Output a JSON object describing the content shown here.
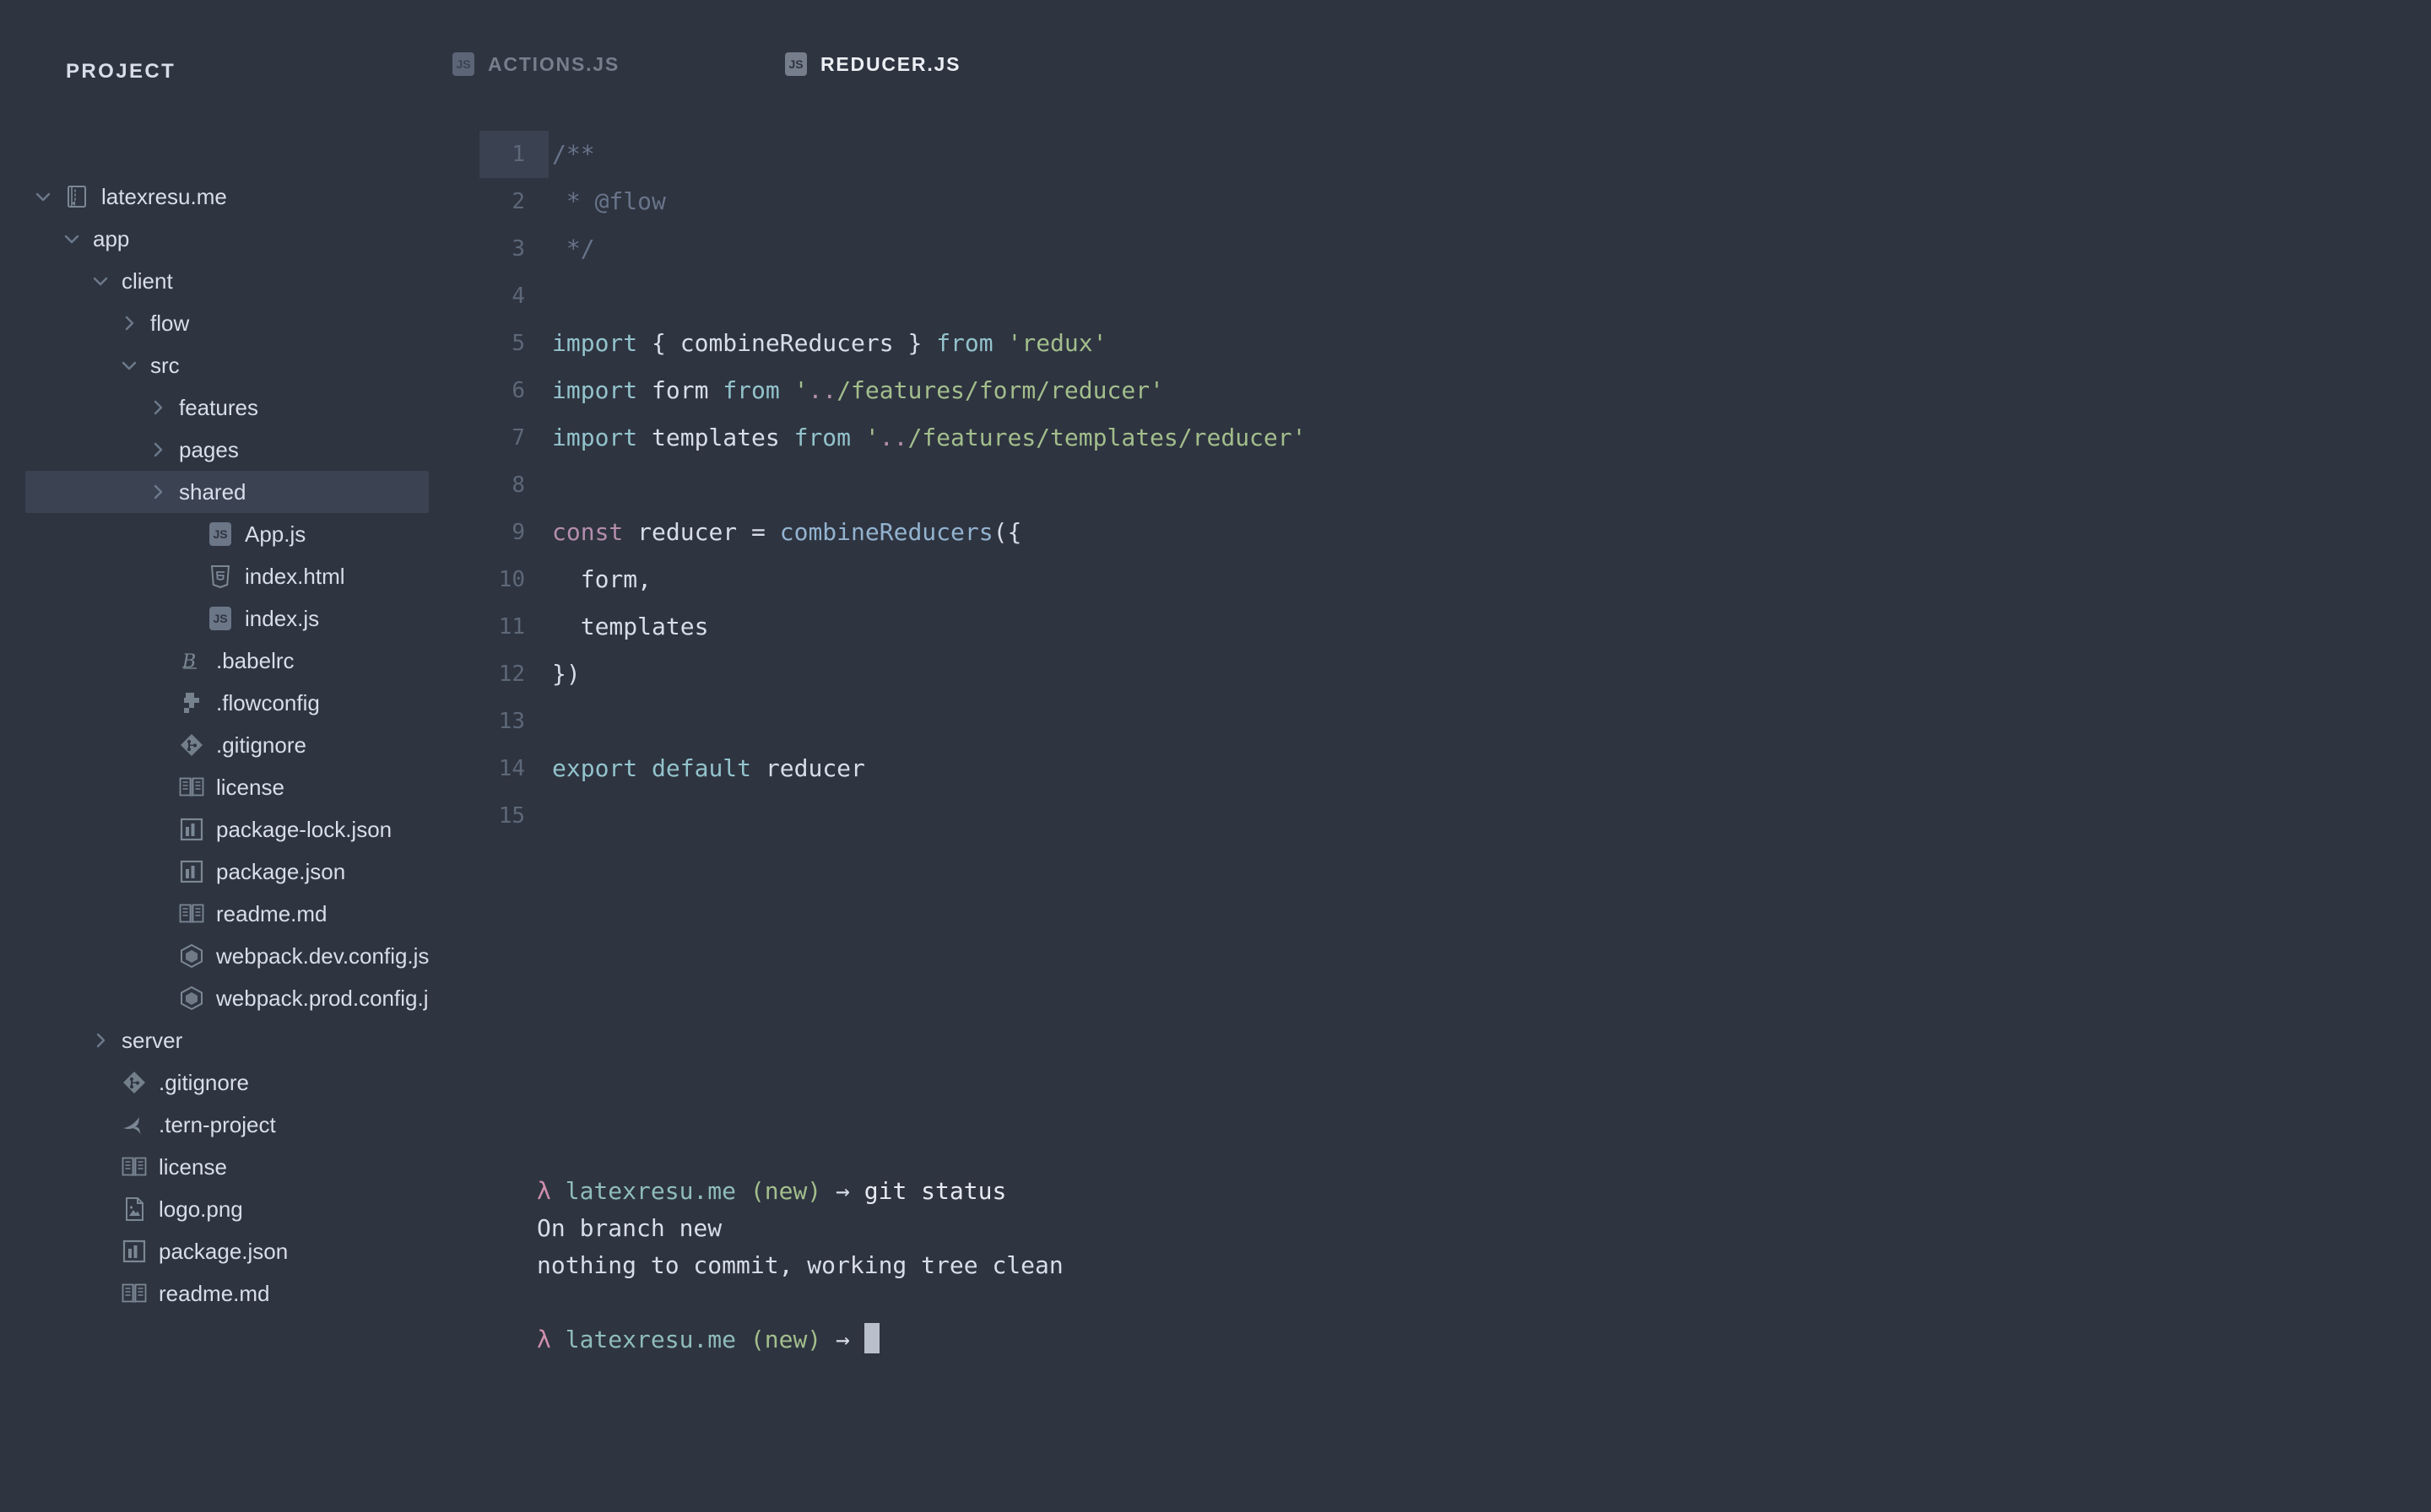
{
  "theme": {
    "bg": "#2e3440",
    "selection": "#3b4252",
    "active_line_gutter": "#3a4150",
    "text": "#d8dee9",
    "muted": "#68748a",
    "keyword": "#b48ead",
    "keyword2": "#93c3cc",
    "function": "#93b3d0",
    "string": "#a3be8c"
  },
  "sidebar": {
    "title": "PROJECT",
    "items": [
      {
        "label": "latexresu.me",
        "indent": 0,
        "chevron": "chevron-down",
        "icon": "repo-book",
        "selected": false
      },
      {
        "label": "app",
        "indent": 1,
        "chevron": "chevron-down",
        "icon": "none",
        "selected": false
      },
      {
        "label": "client",
        "indent": 2,
        "chevron": "chevron-down",
        "icon": "none",
        "selected": false
      },
      {
        "label": "flow",
        "indent": 3,
        "chevron": "chevron-right",
        "icon": "none",
        "selected": false
      },
      {
        "label": "src",
        "indent": 3,
        "chevron": "chevron-down",
        "icon": "none",
        "selected": false
      },
      {
        "label": "features",
        "indent": 4,
        "chevron": "chevron-right",
        "icon": "none",
        "selected": false
      },
      {
        "label": "pages",
        "indent": 4,
        "chevron": "chevron-right",
        "icon": "none",
        "selected": false
      },
      {
        "label": "shared",
        "indent": 4,
        "chevron": "chevron-right",
        "icon": "none",
        "selected": true
      },
      {
        "label": "App.js",
        "indent": 5,
        "chevron": "none",
        "icon": "js-file",
        "selected": false
      },
      {
        "label": "index.html",
        "indent": 5,
        "chevron": "none",
        "icon": "html5-file",
        "selected": false
      },
      {
        "label": "index.js",
        "indent": 5,
        "chevron": "none",
        "icon": "js-file",
        "selected": false
      },
      {
        "label": ".babelrc",
        "indent": 4,
        "chevron": "none",
        "icon": "babel-file",
        "selected": false
      },
      {
        "label": ".flowconfig",
        "indent": 4,
        "chevron": "none",
        "icon": "flow-file",
        "selected": false
      },
      {
        "label": ".gitignore",
        "indent": 4,
        "chevron": "none",
        "icon": "git-file",
        "selected": false
      },
      {
        "label": "license",
        "indent": 4,
        "chevron": "none",
        "icon": "book-file",
        "selected": false
      },
      {
        "label": "package-lock.json",
        "indent": 4,
        "chevron": "none",
        "icon": "json-file",
        "selected": false
      },
      {
        "label": "package.json",
        "indent": 4,
        "chevron": "none",
        "icon": "json-file",
        "selected": false
      },
      {
        "label": "readme.md",
        "indent": 4,
        "chevron": "none",
        "icon": "book-file",
        "selected": false
      },
      {
        "label": "webpack.dev.config.js",
        "indent": 4,
        "chevron": "none",
        "icon": "webpack-file",
        "selected": false
      },
      {
        "label": "webpack.prod.config.js",
        "indent": 4,
        "chevron": "none",
        "icon": "webpack-file",
        "selected": false
      },
      {
        "label": "server",
        "indent": 2,
        "chevron": "chevron-right",
        "icon": "none",
        "selected": false
      },
      {
        "label": ".gitignore",
        "indent": 2,
        "chevron": "none",
        "icon": "git-file",
        "selected": false
      },
      {
        "label": ".tern-project",
        "indent": 2,
        "chevron": "none",
        "icon": "tern-file",
        "selected": false
      },
      {
        "label": "license",
        "indent": 2,
        "chevron": "none",
        "icon": "book-file",
        "selected": false
      },
      {
        "label": "logo.png",
        "indent": 2,
        "chevron": "none",
        "icon": "image-file",
        "selected": false
      },
      {
        "label": "package.json",
        "indent": 2,
        "chevron": "none",
        "icon": "json-file",
        "selected": false
      },
      {
        "label": "readme.md",
        "indent": 2,
        "chevron": "none",
        "icon": "book-file",
        "selected": false
      }
    ]
  },
  "tabs": [
    {
      "label": "ACTIONS.JS",
      "icon": "js-badge",
      "active": false
    },
    {
      "label": "REDUCER.JS",
      "icon": "js-badge",
      "active": true
    }
  ],
  "editor": {
    "active_line": 1,
    "lines": [
      {
        "n": "1",
        "tokens": [
          {
            "t": "/**",
            "c": "comment"
          }
        ]
      },
      {
        "n": "2",
        "tokens": [
          {
            "t": " * @flow",
            "c": "comment"
          }
        ]
      },
      {
        "n": "3",
        "tokens": [
          {
            "t": " */",
            "c": "comment"
          }
        ]
      },
      {
        "n": "4",
        "tokens": []
      },
      {
        "n": "5",
        "tokens": [
          {
            "t": "import",
            "c": "key"
          },
          {
            "t": " { ",
            "c": "plain"
          },
          {
            "t": "combineReducers",
            "c": "plain"
          },
          {
            "t": " } ",
            "c": "plain"
          },
          {
            "t": "from",
            "c": "key"
          },
          {
            "t": " ",
            "c": "plain"
          },
          {
            "t": "'redux'",
            "c": "str"
          }
        ]
      },
      {
        "n": "6",
        "tokens": [
          {
            "t": "import",
            "c": "key"
          },
          {
            "t": " form ",
            "c": "plain"
          },
          {
            "t": "from",
            "c": "key"
          },
          {
            "t": " '",
            "c": "str"
          },
          {
            "t": "..",
            "c": "dots"
          },
          {
            "t": "/features/form/reducer'",
            "c": "str"
          }
        ]
      },
      {
        "n": "7",
        "tokens": [
          {
            "t": "import",
            "c": "key"
          },
          {
            "t": " templates ",
            "c": "plain"
          },
          {
            "t": "from",
            "c": "key"
          },
          {
            "t": " '",
            "c": "str"
          },
          {
            "t": "..",
            "c": "dots"
          },
          {
            "t": "/features/templates/reducer'",
            "c": "str"
          }
        ]
      },
      {
        "n": "8",
        "tokens": []
      },
      {
        "n": "9",
        "tokens": [
          {
            "t": "const",
            "c": "kw"
          },
          {
            "t": " reducer = ",
            "c": "plain"
          },
          {
            "t": "combineReducers",
            "c": "fn"
          },
          {
            "t": "({",
            "c": "plain"
          }
        ]
      },
      {
        "n": "10",
        "tokens": [
          {
            "t": "  form,",
            "c": "plain"
          }
        ]
      },
      {
        "n": "11",
        "tokens": [
          {
            "t": "  templates",
            "c": "plain"
          }
        ]
      },
      {
        "n": "12",
        "tokens": [
          {
            "t": "})",
            "c": "plain"
          }
        ]
      },
      {
        "n": "13",
        "tokens": []
      },
      {
        "n": "14",
        "tokens": [
          {
            "t": "export",
            "c": "key"
          },
          {
            "t": " ",
            "c": "plain"
          },
          {
            "t": "default",
            "c": "key"
          },
          {
            "t": " reducer",
            "c": "plain"
          }
        ]
      },
      {
        "n": "15",
        "tokens": []
      }
    ]
  },
  "terminal": {
    "lines": [
      {
        "type": "prompt",
        "lambda": "λ",
        "host": "latexresu.me",
        "branch": "(new)",
        "arrow": "→",
        "command": "git status"
      },
      {
        "type": "output",
        "text": "On branch new"
      },
      {
        "type": "output",
        "text": "nothing to commit, working tree clean"
      },
      {
        "type": "blank",
        "text": ""
      },
      {
        "type": "prompt-cursor",
        "lambda": "λ",
        "host": "latexresu.me",
        "branch": "(new)",
        "arrow": "→",
        "command": ""
      }
    ]
  }
}
